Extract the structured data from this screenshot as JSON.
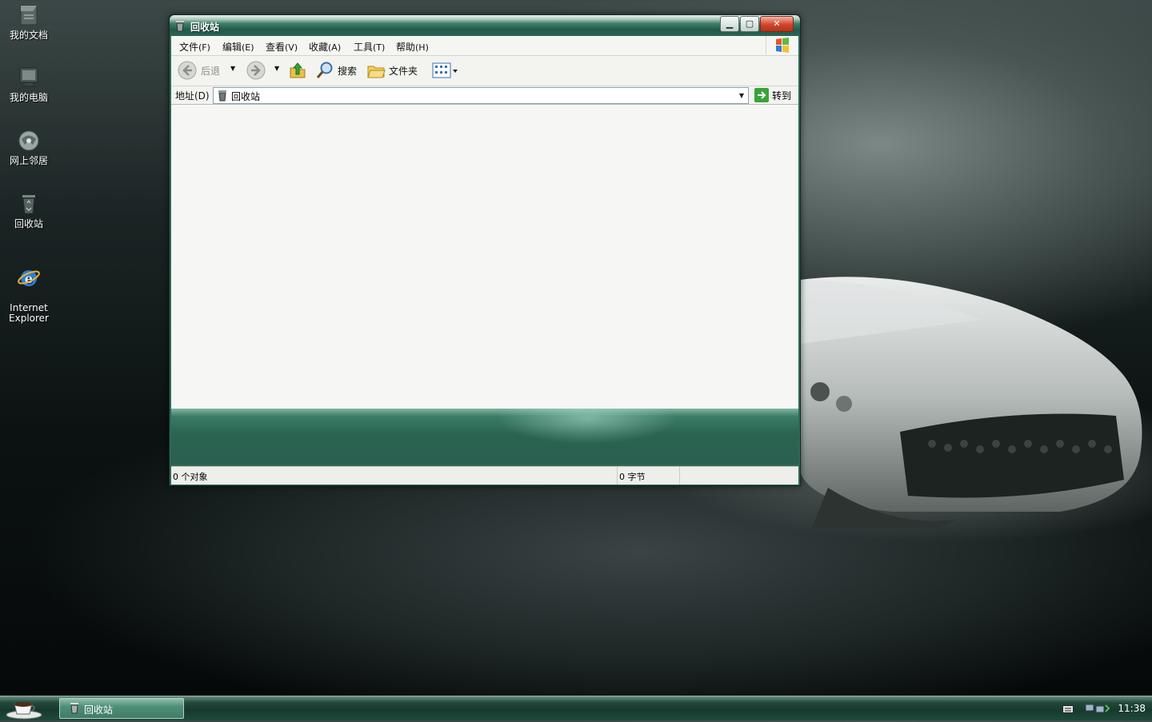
{
  "desktop": {
    "icons": [
      {
        "label": "我的文档",
        "icon": "my-documents-icon"
      },
      {
        "label": "我的电脑",
        "icon": "my-computer-icon"
      },
      {
        "label": "网上邻居",
        "icon": "network-places-icon"
      },
      {
        "label": "回收站",
        "icon": "recycle-bin-icon"
      },
      {
        "label": "Internet\nExplorer",
        "icon": "internet-explorer-icon"
      }
    ]
  },
  "window": {
    "title": "回收站",
    "menu": {
      "file": {
        "label": "文件",
        "key": "(F)"
      },
      "edit": {
        "label": "编辑",
        "key": "(E)"
      },
      "view": {
        "label": "查看",
        "key": "(V)"
      },
      "favorites": {
        "label": "收藏",
        "key": "(A)"
      },
      "tools": {
        "label": "工具",
        "key": "(T)"
      },
      "help": {
        "label": "帮助",
        "key": "(H)"
      }
    },
    "toolbar": {
      "back": "后退",
      "search": "搜索",
      "folders": "文件夹"
    },
    "address": {
      "label": "地址(D)",
      "value": "回收站",
      "go": "转到"
    },
    "status": {
      "objects": "0 个对象",
      "size": "0 字节"
    }
  },
  "taskbar": {
    "task": "回收站",
    "clock": "11:38"
  },
  "colors": {
    "title_green": "#22594a",
    "band_green": "#2b6452",
    "close_red": "#d0432b"
  }
}
